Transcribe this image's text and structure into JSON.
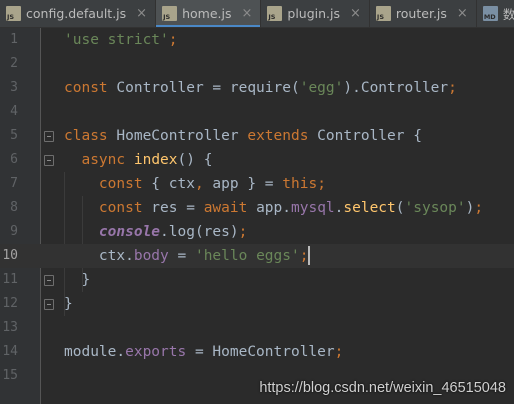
{
  "tabs": [
    {
      "label": "config.default.js",
      "icon": "js-file-icon",
      "badge": "JS",
      "active": false
    },
    {
      "label": "home.js",
      "icon": "js-file-icon",
      "badge": "JS",
      "active": true
    },
    {
      "label": "plugin.js",
      "icon": "js-file-icon",
      "badge": "JS",
      "active": false
    },
    {
      "label": "router.js",
      "icon": "js-file-icon",
      "badge": "JS",
      "active": false
    },
    {
      "label": "数据库设计",
      "icon": "md-file-icon",
      "badge": "MD",
      "active": false
    }
  ],
  "close_glyph": "×",
  "editor": {
    "current_line": 10,
    "lines": [
      {
        "num": "1",
        "code": "'use strict';"
      },
      {
        "num": "2",
        "code": ""
      },
      {
        "num": "3",
        "code": "const Controller = require('egg').Controller;"
      },
      {
        "num": "4",
        "code": ""
      },
      {
        "num": "5",
        "code": "class HomeController extends Controller {"
      },
      {
        "num": "6",
        "code": "  async index() {"
      },
      {
        "num": "7",
        "code": "    const { ctx, app } = this;"
      },
      {
        "num": "8",
        "code": "    const res = await app.mysql.select('sysop');"
      },
      {
        "num": "9",
        "code": "    console.log(res);"
      },
      {
        "num": "10",
        "code": "    ctx.body = 'hello eggs';"
      },
      {
        "num": "11",
        "code": "  }"
      },
      {
        "num": "12",
        "code": "}"
      },
      {
        "num": "13",
        "code": ""
      },
      {
        "num": "14",
        "code": "module.exports = HomeController;"
      },
      {
        "num": "15",
        "code": ""
      }
    ]
  },
  "watermark": "https://blog.csdn.net/weixin_46515048",
  "colors": {
    "background": "#2b2b2b",
    "keyword": "#cc7832",
    "string": "#6a8759",
    "function": "#ffc66d",
    "property": "#9876aa",
    "text": "#a9b7c6",
    "active_tab_underline": "#4a88c7"
  }
}
